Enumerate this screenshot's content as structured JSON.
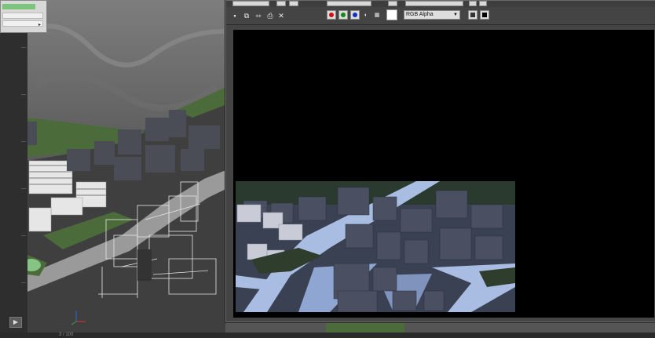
{
  "viewport": {
    "label": "3 / 100",
    "play_symbol": "▶"
  },
  "frame_buffer": {
    "toolbar": {
      "icons": [
        "save-icon",
        "copy-icon",
        "clone-icon",
        "print-icon",
        "clear-icon"
      ],
      "channels": [
        {
          "name": "red-channel-button",
          "color": "#d01010"
        },
        {
          "name": "green-channel-button",
          "color": "#108a10"
        },
        {
          "name": "blue-channel-button",
          "color": "#1030c0"
        }
      ],
      "display_channel": "RGB Alpha"
    },
    "colors": {
      "canvas": "#000000",
      "panel": "#444444",
      "accent_green": "#7cc47c"
    }
  }
}
